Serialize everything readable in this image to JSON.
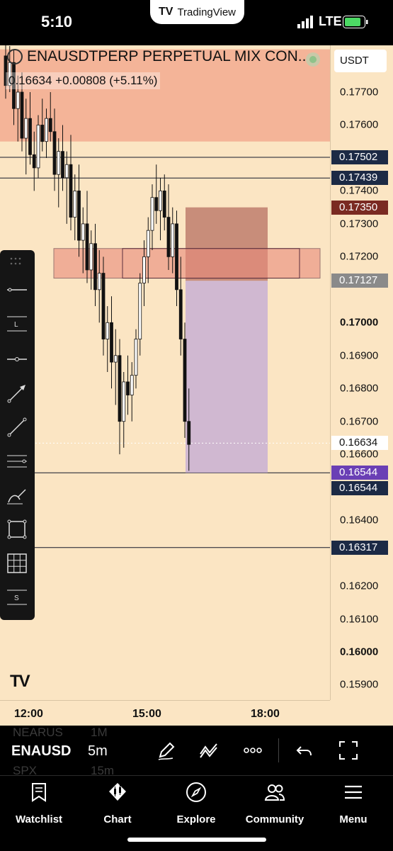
{
  "status_bar": {
    "time": "5:10",
    "network": "LTE"
  },
  "app_badge": {
    "name": "TradingView"
  },
  "chart": {
    "symbol_title": "ENAUSDTPERP PERPETUAL MIX CON...",
    "quote": "0.16634 +0.00808 (+5.11%)",
    "currency": "USDT",
    "price_ticks": [
      {
        "label": "0.17700",
        "value": 0.177
      },
      {
        "label": "0.17600",
        "value": 0.176
      },
      {
        "label": "0.17400",
        "value": 0.174
      },
      {
        "label": "0.17300",
        "value": 0.173
      },
      {
        "label": "0.17200",
        "value": 0.172
      },
      {
        "label": "0.17000",
        "value": 0.17,
        "bold": true
      },
      {
        "label": "0.16900",
        "value": 0.169
      },
      {
        "label": "0.16800",
        "value": 0.168
      },
      {
        "label": "0.16700",
        "value": 0.167
      },
      {
        "label": "0.16600",
        "value": 0.166
      },
      {
        "label": "0.16400",
        "value": 0.164
      },
      {
        "label": "0.16200",
        "value": 0.162
      },
      {
        "label": "0.16100",
        "value": 0.161
      },
      {
        "label": "0.16000",
        "value": 0.16,
        "bold": true
      },
      {
        "label": "0.15900",
        "value": 0.159
      }
    ],
    "price_tags": [
      {
        "label": "0.17502",
        "value": 0.17502,
        "color": "#1c2a45"
      },
      {
        "label": "0.17439",
        "value": 0.17439,
        "color": "#1c2a45"
      },
      {
        "label": "0.17350",
        "value": 0.1735,
        "color": "#7a2a22"
      },
      {
        "label": "0.17127",
        "value": 0.17127,
        "color": "#8a8a8a"
      },
      {
        "label": "0.16634",
        "value": 0.16634,
        "color": "#ffffff",
        "light": true
      },
      {
        "label": "0.16544",
        "value": 0.16544,
        "color": "#6a3fb5"
      },
      {
        "label": "0.16544",
        "value": 0.16544,
        "color": "#1c2a45"
      },
      {
        "label": "0.16317",
        "value": 0.16317,
        "color": "#1c2a45"
      }
    ],
    "horizontal_lines": [
      0.17502,
      0.17439,
      0.16544,
      0.16317
    ],
    "time_labels": [
      "12:00",
      "15:00",
      "18:00"
    ]
  },
  "chart_data": {
    "type": "candlestick",
    "symbol": "ENAUSDTPERP",
    "interval": "5m",
    "x_labels": [
      "12:00",
      "15:00",
      "18:00"
    ],
    "ylim": [
      0.1585,
      0.1783
    ],
    "annotations": {
      "supply_zone": [
        0.1755,
        0.1783
      ],
      "resistance_rectangle": [
        0.17135,
        0.17225
      ],
      "short_position": {
        "entry": 0.17127,
        "stop": 0.1735,
        "target": 0.16544
      }
    },
    "candles": [
      [
        0.1781,
        0.1786,
        0.1768,
        0.1772
      ],
      [
        0.1772,
        0.1784,
        0.177,
        0.1779
      ],
      [
        0.1779,
        0.1783,
        0.176,
        0.1765
      ],
      [
        0.1765,
        0.1775,
        0.1755,
        0.177
      ],
      [
        0.177,
        0.1776,
        0.1752,
        0.1756
      ],
      [
        0.1756,
        0.1768,
        0.1745,
        0.1762
      ],
      [
        0.1762,
        0.177,
        0.1748,
        0.1751
      ],
      [
        0.1751,
        0.1758,
        0.174,
        0.1747
      ],
      [
        0.1747,
        0.1763,
        0.1744,
        0.176
      ],
      [
        0.176,
        0.1768,
        0.1752,
        0.1755
      ],
      [
        0.1755,
        0.1765,
        0.175,
        0.1762
      ],
      [
        0.1762,
        0.177,
        0.1755,
        0.1758
      ],
      [
        0.1758,
        0.1765,
        0.174,
        0.1745
      ],
      [
        0.1745,
        0.1756,
        0.1735,
        0.1752
      ],
      [
        0.1752,
        0.176,
        0.174,
        0.1744
      ],
      [
        0.1744,
        0.1752,
        0.173,
        0.1748
      ],
      [
        0.1748,
        0.1757,
        0.1728,
        0.1732
      ],
      [
        0.1732,
        0.1745,
        0.1725,
        0.174
      ],
      [
        0.174,
        0.1748,
        0.172,
        0.1725
      ],
      [
        0.1725,
        0.1735,
        0.1715,
        0.173
      ],
      [
        0.173,
        0.174,
        0.1712,
        0.1716
      ],
      [
        0.1716,
        0.1728,
        0.171,
        0.1724
      ],
      [
        0.1724,
        0.173,
        0.1705,
        0.171
      ],
      [
        0.171,
        0.1722,
        0.17,
        0.1715
      ],
      [
        0.1715,
        0.172,
        0.169,
        0.1695
      ],
      [
        0.1695,
        0.1705,
        0.1685,
        0.17
      ],
      [
        0.17,
        0.1708,
        0.168,
        0.1688
      ],
      [
        0.1688,
        0.1698,
        0.1675,
        0.169
      ],
      [
        0.169,
        0.1695,
        0.166,
        0.167
      ],
      [
        0.167,
        0.1685,
        0.1662,
        0.1682
      ],
      [
        0.1682,
        0.169,
        0.1672,
        0.1678
      ],
      [
        0.1678,
        0.1688,
        0.167,
        0.1684
      ],
      [
        0.1684,
        0.1698,
        0.168,
        0.1695
      ],
      [
        0.1695,
        0.1715,
        0.169,
        0.1712
      ],
      [
        0.1712,
        0.1725,
        0.1705,
        0.172
      ],
      [
        0.172,
        0.1732,
        0.1712,
        0.1728
      ],
      [
        0.1728,
        0.1742,
        0.1722,
        0.1738
      ],
      [
        0.1738,
        0.1748,
        0.173,
        0.1734
      ],
      [
        0.1734,
        0.1744,
        0.1725,
        0.174
      ],
      [
        0.174,
        0.1745,
        0.1728,
        0.1732
      ],
      [
        0.1732,
        0.1742,
        0.1716,
        0.172
      ],
      [
        0.172,
        0.1735,
        0.1715,
        0.173
      ],
      [
        0.173,
        0.1734,
        0.1705,
        0.171
      ],
      [
        0.171,
        0.172,
        0.169,
        0.1695
      ],
      [
        0.1695,
        0.17,
        0.1665,
        0.167
      ],
      [
        0.167,
        0.168,
        0.1655,
        0.1663
      ]
    ]
  },
  "toolbar": {
    "tools": [
      "horizontal-line-tool",
      "horizontal-line-labeled-tool",
      "horizontal-ray-tool",
      "arrow-tool",
      "trend-line-tool",
      "parallel-lines-tool",
      "brush-tool",
      "rectangle-tool",
      "grid-tool",
      "settings-s-tool"
    ]
  },
  "bottom_toolbar": {
    "symbol": "ENAUSD",
    "interval": "5m",
    "ghost_rows": [
      {
        "symbol": "NEARUS",
        "interval": "1M"
      },
      {
        "symbol": "SPX",
        "interval": "15m"
      }
    ]
  },
  "tabs": [
    {
      "label": "Watchlist",
      "icon": "bookmark-icon"
    },
    {
      "label": "Chart",
      "icon": "chart-icon"
    },
    {
      "label": "Explore",
      "icon": "compass-icon"
    },
    {
      "label": "Community",
      "icon": "community-icon"
    },
    {
      "label": "Menu",
      "icon": "menu-icon"
    }
  ]
}
